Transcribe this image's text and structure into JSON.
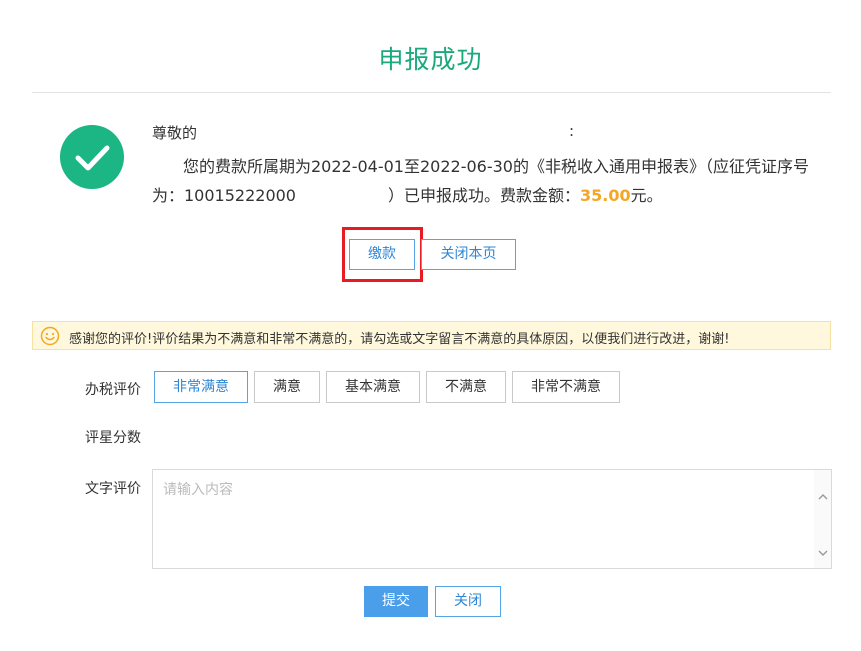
{
  "title": "申报成功",
  "message": {
    "greeting": "尊敬的",
    "colon": ":",
    "line1": "您的费款所属期为2022-04-01至2022-06-30的《非税收入通用申报表》（应征凭证序号",
    "line2_prefix": "为：10015222000",
    "line2_middle": "）已申报成功。费款金额：",
    "amount": "35.00",
    "currency": "元。"
  },
  "actions": {
    "pay_label": "缴款",
    "close_page_label": "关闭本页"
  },
  "notice": {
    "text": "感谢您的评价!评价结果为不满意和非常不满意的，请勾选或文字留言不满意的具体原因，以便我们进行改进，谢谢!"
  },
  "evaluation": {
    "tax_label": "办税评价",
    "options": [
      "非常满意",
      "满意",
      "基本满意",
      "不满意",
      "非常不满意"
    ],
    "selected": "非常满意",
    "star_label": "评星分数",
    "text_label": "文字评价",
    "text_placeholder": "请输入内容"
  },
  "footer": {
    "submit_label": "提交",
    "close_label": "关闭"
  },
  "colors": {
    "title": "#1aa97b",
    "success": "#1cb584",
    "accent": "#2e86d6",
    "amount": "#f5a623",
    "highlight": "#e81b23"
  },
  "icons": {
    "success": "check-circle-icon",
    "notice": "smile-icon",
    "scroll_up": "chevron-up-icon",
    "scroll_down": "chevron-down-icon"
  }
}
